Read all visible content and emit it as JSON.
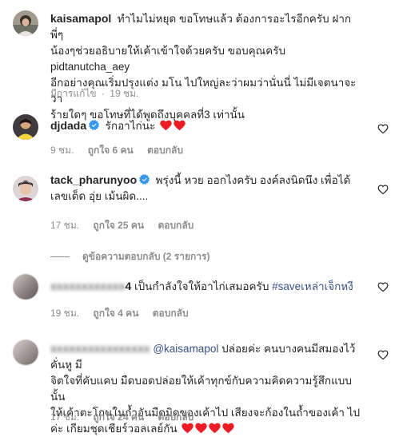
{
  "comments": [
    {
      "username": "kaisamapol",
      "verified": false,
      "text_lines": [
        "ทำไมไม่หยุด ขอโทษแล้ว ต้องการอะไรอีกครับ ฝากพี่ๆ",
        "น้องๆช่วยอธิบายให้เค้าเข้าใจด้วยครับ ขอบคุณครับ pidtanutcha_aey",
        "อีกอย่างคุณเริ่มปรุงแต่ง มโน ไปใหญ่ละว่าผมว่านั่นนี่ ไม่มีเจตนาจะว่า",
        "ร้ายใดๆ ขอโทษที่ได้พูดถึงบุคคลที่3 เท่านั้น"
      ],
      "meta": {
        "edited": "มีการแก้ไข",
        "separator": "·",
        "time": "19 ชม."
      }
    },
    {
      "username": "djdada",
      "verified": true,
      "text": "รักอาไก่นะ",
      "meta": {
        "time": "9 ชม.",
        "likes": "ถูกใจ 6 คน",
        "reply": "ตอบกลับ"
      }
    },
    {
      "username": "tack_pharunyoo",
      "verified": true,
      "text_line1": "พรุ่งนี้ หวย ออกไงครับ องค์ลงนิดนึง เพื่อได้",
      "text_line2": "เลขเด็ด อุ่ย เม้นผิด....",
      "meta": {
        "time": "17 ชม.",
        "likes": "ถูกใจ 25 คน",
        "reply": "ตอบกลับ"
      },
      "view_replies": "ดูข้อความตอบกลับ (2 รายการ)"
    },
    {
      "username": "blurred",
      "name_tail": "4",
      "text": "เป็นกำลังใจให้อาไก่เสมอครับ",
      "hashtag": "#saveเหล่าเจ็กหงี",
      "meta": {
        "time": "19 ชม.",
        "likes": "ถูกใจ 4 คน",
        "reply": "ตอบกลับ"
      }
    },
    {
      "username": "blurred",
      "mention": "@kaisamapol",
      "text_line1": "ปล่อยค่ะ คนบางคนมีสมองไว้คั่นหู มี",
      "text_lines": [
        "จิตใจที่คับแคบ มืดบอดปล่อยให้เค้าทุกข์กับความคิดความรู้สึกแบบนั้น",
        "ให้เค้าตะโกนในถ้ำอันมืดมิดของเค้าไป เสียงจะก้องในถ้ำของเค้า ไป"
      ],
      "text_last": "ค่ะ เกียมชุดเชียร์วอลเลย์กัน",
      "meta": {
        "time": "17 ชม.",
        "likes": "ถูกใจ 24 คน",
        "reply": "ตอบกลับ"
      }
    }
  ],
  "colors": {
    "heart_red": "#ed1c24",
    "link_blue": "#385185",
    "verified_blue": "#3897f0",
    "meta_gray": "#8e8e8e"
  },
  "icons": {
    "verified": "verified-badge-icon",
    "like": "heart-outline-icon",
    "emoji": "red-heart-emoji"
  }
}
